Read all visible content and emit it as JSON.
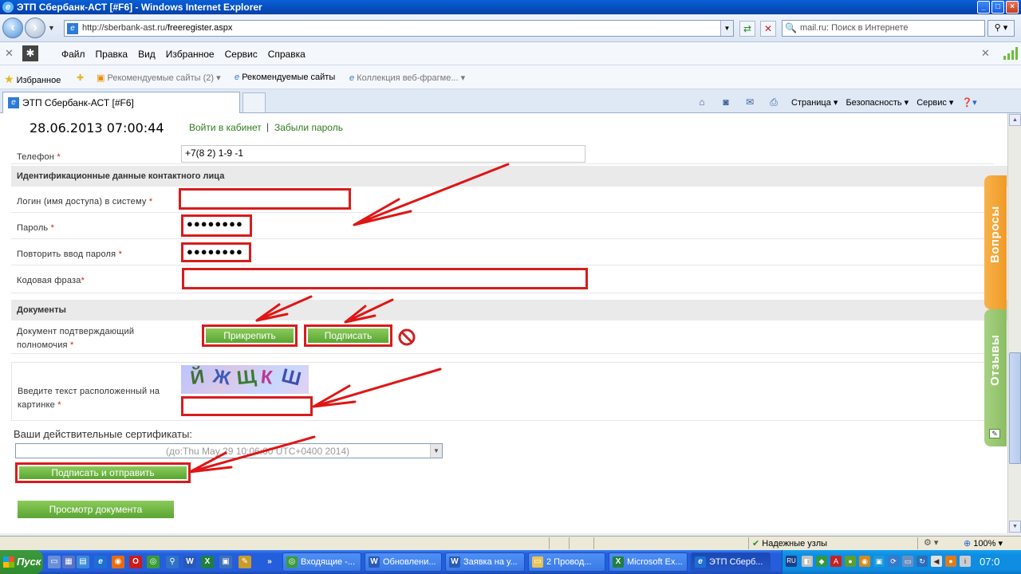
{
  "window": {
    "title": "ЭТП Сбербанк-АСТ [#F6] - Windows Internet Explorer",
    "controls": [
      "_",
      "□",
      "×"
    ]
  },
  "address": {
    "url_host": "http://sberbank-ast.ru/",
    "url_path": "freeregister.aspx",
    "search_placeholder": "mail.ru: Поиск в Интернете"
  },
  "menu": [
    "Файл",
    "Правка",
    "Вид",
    "Избранное",
    "Сервис",
    "Справка"
  ],
  "favorites": {
    "label": "Избранное",
    "items": [
      "Рекомендуемые сайты (2)",
      "Рекомендуемые сайты",
      "Коллекция веб-фрагме..."
    ]
  },
  "tab": {
    "title": "ЭТП Сбербанк-АСТ [#F6]"
  },
  "commandbar": {
    "page": "Страница",
    "security": "Безопасность",
    "tools": "Сервис"
  },
  "header": {
    "datetime": "28.06.2013 07:00:44",
    "login_link": "Войти в кабинет",
    "separator": "|",
    "forgot_link": "Забыли пароль"
  },
  "form": {
    "phone_label": "Телефон",
    "phone_value": "+7(8    2)  1-9  -1",
    "contact_section": "Идентификационные данные контактного лица",
    "login_label": "Логин (имя доступа) в систему",
    "login_value": "",
    "password_label": "Пароль",
    "password_value": "●●●●●●●●",
    "password_repeat_label": "Повторить ввод пароля",
    "password_repeat_value": "●●●●●●●●",
    "code_phrase_label": "Кодовая фраза",
    "code_phrase_value": "",
    "documents_section": "Документы",
    "doc_label_1": "Документ подтверждающий",
    "doc_label_2": "полномочия",
    "attach_button": "Прикрепить",
    "sign_button": "Подписать",
    "captcha_label_1": "Введите текст расположенный на",
    "captcha_label_2": "картинке",
    "captcha_letters": [
      "Й",
      "Ж",
      "Щ",
      "К",
      "Ш"
    ],
    "captcha_value": "",
    "cert_label": "Ваши действительные сертификаты:",
    "cert_selected": "(до:Thu May 29 10:06:00 UTC+0400 2014)",
    "sign_send_button": "Подписать и отправить",
    "preview_button": "Просмотр документа",
    "required_mark": "*"
  },
  "side_tabs": {
    "questions": "Вопросы",
    "reviews": "Отзывы"
  },
  "status": {
    "zone": "Надежные узлы",
    "zoom": "100%"
  },
  "taskbar": {
    "start": "Пуск",
    "items": [
      "Входящие -...",
      "Обновлени...",
      "Заявка на у...",
      "2 Провод...",
      "Microsoft Ex...",
      "ЭТП Сберб..."
    ],
    "lang": "RU",
    "clock": "07:0"
  },
  "colors": {
    "highlight_red": "#d81c1c",
    "button_green": "#6cb33f",
    "link_green": "#2e7d1d"
  }
}
